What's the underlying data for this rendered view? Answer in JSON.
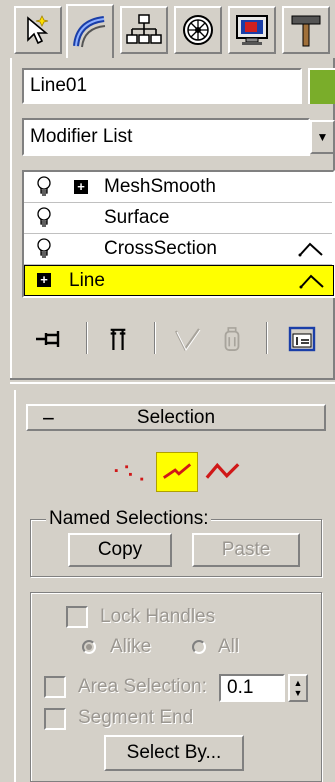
{
  "command_panel": {
    "tabs": [
      {
        "name": "create",
        "icon": "create-pointer-icon"
      },
      {
        "name": "modify",
        "icon": "modify-bend-icon",
        "active": true
      },
      {
        "name": "hierarchy",
        "icon": "hierarchy-icon"
      },
      {
        "name": "motion",
        "icon": "motion-wheel-icon"
      },
      {
        "name": "display",
        "icon": "display-monitor-icon"
      },
      {
        "name": "utilities",
        "icon": "utilities-hammer-icon"
      }
    ]
  },
  "object": {
    "name_value": "Line01",
    "color": "#7aad2a"
  },
  "modifier_list": {
    "label": "Modifier List"
  },
  "stack": {
    "items": [
      {
        "label": "MeshSmooth",
        "has_bulb": true,
        "has_plus": true
      },
      {
        "label": "Surface",
        "has_bulb": true,
        "has_plus": false
      },
      {
        "label": "CrossSection",
        "has_bulb": true,
        "has_plus": false,
        "has_subobject_icon": true
      },
      {
        "label": "Line",
        "has_bulb": false,
        "has_plus": true,
        "selected": true,
        "has_subobject_icon": true
      }
    ],
    "selected_color": "#ffff00"
  },
  "stack_toolbar": {
    "icons": [
      "pin-stack-icon",
      "show-end-result-icon",
      "make-unique-icon",
      "remove-modifier-icon",
      "configure-modifier-sets-icon"
    ]
  },
  "selection_rollout": {
    "title": "Selection",
    "collapse_symbol": "−",
    "subobject_levels": [
      "vertex-level-icon",
      "segment-level-icon",
      "spline-level-icon"
    ],
    "active_level": "segment",
    "named_selections": {
      "label": "Named Selections:",
      "copy": "Copy",
      "paste": "Paste"
    },
    "lock_handles": {
      "label": "Lock Handles",
      "alike": "Alike",
      "all": "All"
    },
    "area_selection": {
      "label": "Area Selection:",
      "value": "0.1"
    },
    "segment_end": "Segment End",
    "select_by": "Select By..."
  }
}
